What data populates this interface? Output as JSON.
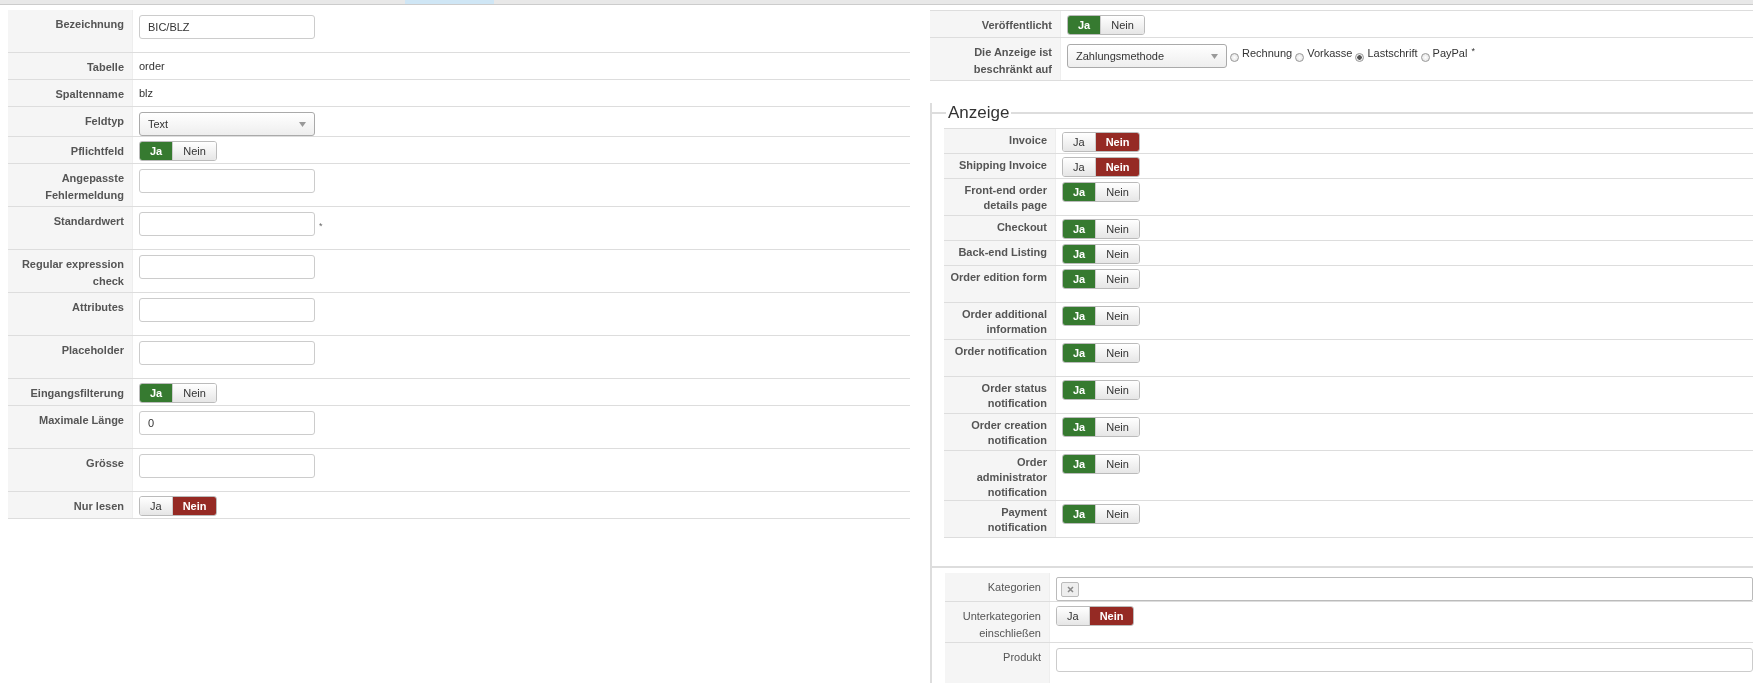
{
  "field_form": {
    "rows": [
      {
        "label": "Bezeichnung",
        "kind": "input",
        "value": "BIC/BLZ"
      },
      {
        "label": "Tabelle",
        "kind": "static",
        "value": "order"
      },
      {
        "label": "Spaltenname",
        "kind": "static",
        "value": "blz"
      },
      {
        "label": "Feldtyp",
        "kind": "select",
        "value": "Text"
      },
      {
        "label": "Pflichtfeld",
        "kind": "toggle",
        "options": [
          {
            "label": "Ja",
            "selected": true
          },
          {
            "label": "Nein",
            "selected": false
          }
        ]
      },
      {
        "label": "Angepasste Fehlermeldung",
        "kind": "input"
      },
      {
        "label": "Standardwert",
        "kind": "input",
        "required_mark": "*"
      },
      {
        "label": "Regular expression check",
        "kind": "input"
      },
      {
        "label": "Attributes",
        "kind": "input"
      },
      {
        "label": "Placeholder",
        "kind": "input"
      },
      {
        "label": "Eingangsfilterung",
        "kind": "toggle",
        "options": [
          {
            "label": "Ja",
            "selected": true
          },
          {
            "label": "Nein",
            "selected": false
          }
        ]
      },
      {
        "label": "Maximale Länge",
        "kind": "input",
        "value": "0"
      },
      {
        "label": "Grösse",
        "kind": "input"
      },
      {
        "label": "Nur lesen",
        "kind": "toggle",
        "options": [
          {
            "label": "Ja",
            "selected": false
          },
          {
            "label": "Nein",
            "selected": true
          }
        ]
      }
    ]
  },
  "publish_form": {
    "rows": [
      {
        "label": "Veröffentlicht",
        "kind": "toggle",
        "options": [
          {
            "label": "Ja",
            "selected": true
          },
          {
            "label": "Nein",
            "selected": false
          }
        ]
      },
      {
        "label": "Die Anzeige ist beschränkt auf",
        "kind": "restriction",
        "select_value": "Zahlungsmethode",
        "radios": [
          {
            "label": "Rechnung",
            "selected": false
          },
          {
            "label": "Vorkasse",
            "selected": false
          },
          {
            "label": "Lastschrift",
            "selected": true
          },
          {
            "label": "PayPal",
            "selected": false
          }
        ],
        "required_mark": "*"
      }
    ]
  },
  "display_section": {
    "legend": "Anzeige",
    "rows": [
      {
        "label": "Invoice",
        "options": [
          {
            "label": "Ja",
            "selected": false
          },
          {
            "label": "Nein",
            "selected": true
          }
        ]
      },
      {
        "label": "Shipping Invoice",
        "options": [
          {
            "label": "Ja",
            "selected": false
          },
          {
            "label": "Nein",
            "selected": true
          }
        ]
      },
      {
        "label": "Front-end order details page",
        "options": [
          {
            "label": "Ja",
            "selected": true
          },
          {
            "label": "Nein",
            "selected": false
          }
        ]
      },
      {
        "label": "Checkout",
        "options": [
          {
            "label": "Ja",
            "selected": true
          },
          {
            "label": "Nein",
            "selected": false
          }
        ]
      },
      {
        "label": "Back-end Listing",
        "options": [
          {
            "label": "Ja",
            "selected": true
          },
          {
            "label": "Nein",
            "selected": false
          }
        ]
      },
      {
        "label": "Order edition form",
        "options": [
          {
            "label": "Ja",
            "selected": true
          },
          {
            "label": "Nein",
            "selected": false
          }
        ]
      },
      {
        "label": "Order additional information",
        "options": [
          {
            "label": "Ja",
            "selected": true
          },
          {
            "label": "Nein",
            "selected": false
          }
        ]
      },
      {
        "label": "Order notification",
        "options": [
          {
            "label": "Ja",
            "selected": true
          },
          {
            "label": "Nein",
            "selected": false
          }
        ]
      },
      {
        "label": "Order status notification",
        "options": [
          {
            "label": "Ja",
            "selected": true
          },
          {
            "label": "Nein",
            "selected": false
          }
        ]
      },
      {
        "label": "Order creation notification",
        "options": [
          {
            "label": "Ja",
            "selected": true
          },
          {
            "label": "Nein",
            "selected": false
          }
        ]
      },
      {
        "label": "Order administrator notification",
        "options": [
          {
            "label": "Ja",
            "selected": true
          },
          {
            "label": "Nein",
            "selected": false
          }
        ]
      },
      {
        "label": "Payment notification",
        "options": [
          {
            "label": "Ja",
            "selected": true
          },
          {
            "label": "Nein",
            "selected": false
          }
        ]
      }
    ]
  },
  "category_form": {
    "rows": [
      {
        "label": "Kategorien",
        "kind": "tags"
      },
      {
        "label": "Unterkategorien einschließen",
        "kind": "toggle",
        "options": [
          {
            "label": "Ja",
            "selected": false
          },
          {
            "label": "Nein",
            "selected": true
          }
        ]
      },
      {
        "label": "Produkt",
        "kind": "input"
      }
    ]
  }
}
